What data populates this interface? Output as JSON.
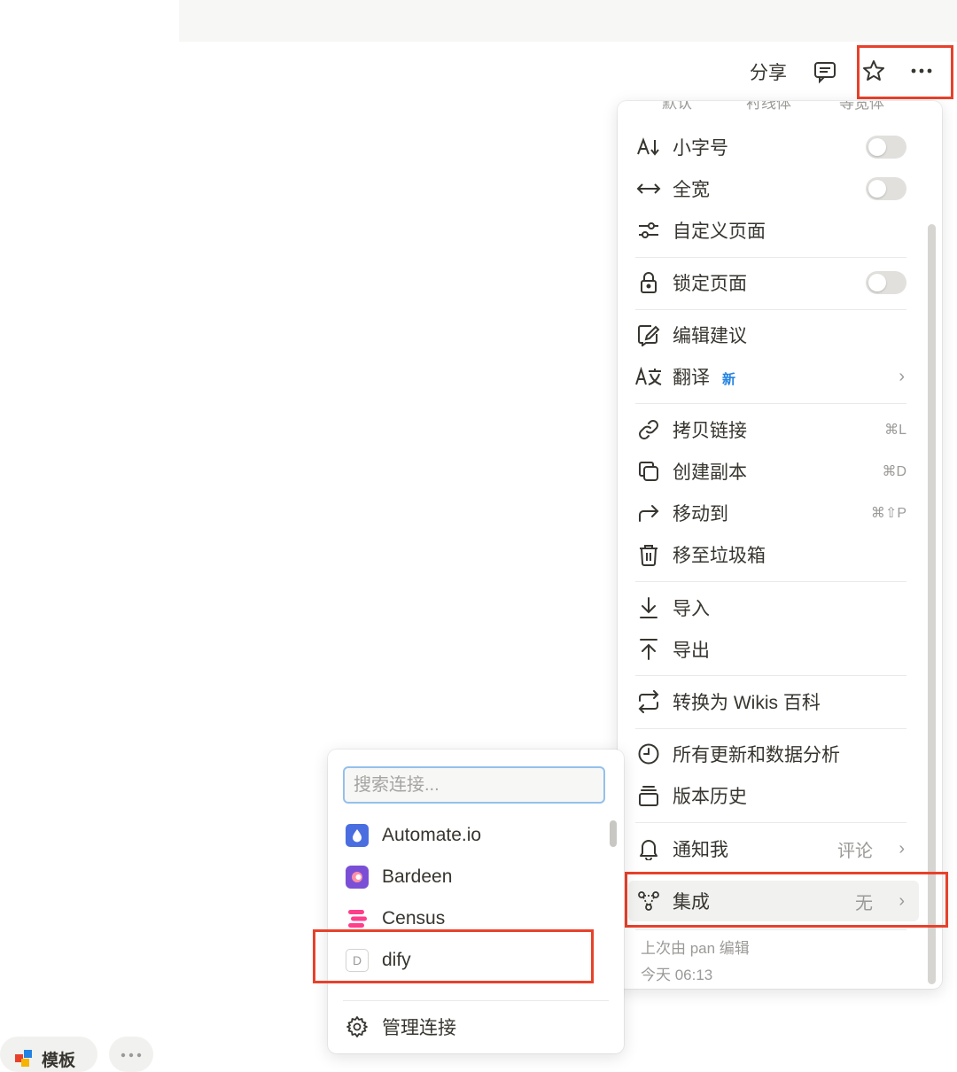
{
  "header": {
    "share_label": "分享",
    "comment_icon": "comment-icon",
    "star_icon": "star-icon",
    "more_icon": "more-horizontal-icon"
  },
  "menu": {
    "cut_off_labels": [
      "默认",
      "衬线体",
      "等宽体"
    ],
    "items": [
      {
        "label": "小字号",
        "icon": "font-size-icon",
        "toggle": false
      },
      {
        "label": "全宽",
        "icon": "arrows-horizontal-icon",
        "toggle": false
      },
      {
        "label": "自定义页面",
        "icon": "sliders-icon"
      },
      {
        "label": "锁定页面",
        "icon": "lock-icon",
        "toggle": false
      },
      {
        "label": "编辑建议",
        "icon": "suggest-edit-icon"
      },
      {
        "label": "翻译",
        "icon": "translate-icon",
        "badge": "新"
      },
      {
        "label": "拷贝链接",
        "icon": "link-icon",
        "shortcut": "⌘L"
      },
      {
        "label": "创建副本",
        "icon": "duplicate-icon",
        "shortcut": "⌘D"
      },
      {
        "label": "移动到",
        "icon": "move-arrow-icon",
        "shortcut": "⌘⇧P"
      },
      {
        "label": "移至垃圾箱",
        "icon": "trash-icon"
      },
      {
        "label": "导入",
        "icon": "import-icon"
      },
      {
        "label": "导出",
        "icon": "export-icon"
      },
      {
        "label": "转换为 Wikis 百科",
        "icon": "convert-icon"
      },
      {
        "label": "所有更新和数据分析",
        "icon": "clock-icon"
      },
      {
        "label": "版本历史",
        "icon": "version-history-icon"
      },
      {
        "label": "通知我",
        "icon": "bell-icon",
        "value": "评论"
      },
      {
        "label": "集成",
        "icon": "integration-icon",
        "value": "无"
      }
    ],
    "footer": {
      "last_edited": "上次由 pan 编辑",
      "time": "今天 06:13"
    }
  },
  "submenu": {
    "search_placeholder": "搜索连接...",
    "connections": [
      {
        "label": "Automate.io",
        "icon": "automateio-logo-icon",
        "color": "#4a6ee0"
      },
      {
        "label": "Bardeen",
        "icon": "bardeen-logo-icon",
        "color": "#7a4fd6"
      },
      {
        "label": "Census",
        "icon": "census-logo-icon",
        "color": "#ff3d8b"
      },
      {
        "label": "dify",
        "icon": "dify-placeholder-icon",
        "letter": "D"
      }
    ],
    "manage_label": "管理连接",
    "manage_icon": "gear-icon"
  },
  "bottom": {
    "templates_label": "模板"
  },
  "colors": {
    "highlight_box": "#e8412b",
    "new_badge": "#2383e2",
    "search_focus": "#94c0ec"
  }
}
